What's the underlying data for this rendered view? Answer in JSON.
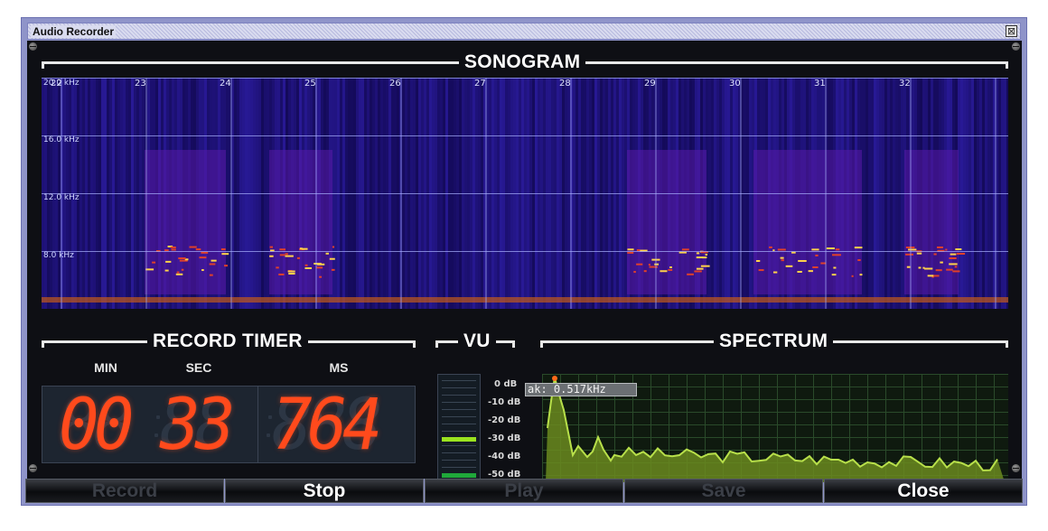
{
  "window": {
    "title": "Audio Recorder",
    "close_glyph": "⊠"
  },
  "sonogram": {
    "title": "SONOGRAM",
    "freq_labels": [
      "20.0 kHz",
      "16.0 kHz",
      "12.0 kHz",
      "8.0 kHz"
    ],
    "time_labels": [
      "22",
      "23",
      "24",
      "25",
      "26",
      "27",
      "28",
      "29",
      "30",
      "31",
      "32"
    ]
  },
  "timer": {
    "title": "RECORD TIMER",
    "col_min": "MIN",
    "col_sec": "SEC",
    "col_ms": "MS",
    "min": "00",
    "sec": "33",
    "ms": "764",
    "ghost_2": "88",
    "ghost_3": "888"
  },
  "vu": {
    "title": "VU",
    "labels": [
      "0 dB",
      "-10 dB",
      "-20 dB",
      "-30 dB",
      "-40 dB",
      "-50 dB"
    ],
    "peak_level_db": -30,
    "base_level_db": -50,
    "peak_color": "#9be31f",
    "base_color": "#1fa83a"
  },
  "spectrum": {
    "title": "SPECTRUM",
    "peak_tooltip": "ak: 0.517kHz",
    "fill_color": "#6a8a1e",
    "line_color": "#b8e04a",
    "peak_marker_color": "#ff6a1a"
  },
  "buttons": [
    {
      "label": "Record",
      "enabled": false
    },
    {
      "label": "Stop",
      "enabled": true
    },
    {
      "label": "Play",
      "enabled": false
    },
    {
      "label": "Save",
      "enabled": false
    },
    {
      "label": "Close",
      "enabled": true
    }
  ]
}
